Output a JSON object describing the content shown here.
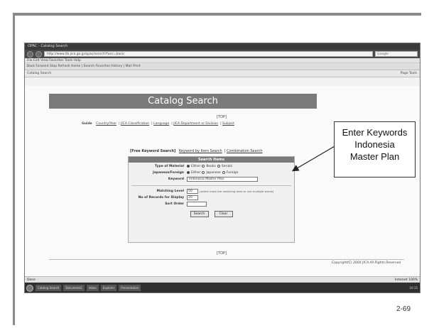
{
  "slide": {
    "page_number": "2-69"
  },
  "browser": {
    "title": "OPAC - Catalog Search",
    "url": "http://www.lib.jica.go.jp/opac/search?func=basic",
    "search_placeholder": "Google",
    "menu": "File  Edit  View  Favorites  Tools  Help",
    "toolbar": "Back  Forward  Stop  Refresh  Home  |  Search  Favorites  History  |  Mail  Print",
    "tab_label": "Catalog Search",
    "tab_tools": "Page  Tools",
    "status_left": "Done",
    "status_right": "Internet  100%",
    "taskbar_items": [
      "Catalog Search",
      "Document1",
      "Inbox",
      "Explorer",
      "Presentation"
    ],
    "tray_time": "10:15"
  },
  "page": {
    "banner": "Catalog Search",
    "top_link": "[TOP]",
    "nav_prefix": "Guide",
    "nav_links": [
      "Country/Year",
      "JICA Classification",
      "Language",
      "JICA Department or Division",
      "Subject"
    ],
    "search_tabs_label": "[Free Keyword Search]",
    "search_tab_links": [
      "Keyword by Item Search",
      "Combination Search"
    ],
    "form_title": "Search Items",
    "type_label": "Type of Material",
    "type_options": [
      "Either",
      "Books",
      "Serials"
    ],
    "lang_label": "Japanese/Foreign",
    "lang_options": [
      "Either",
      "Japanese",
      "Foreign"
    ],
    "keyword_label": "Keyword",
    "keyword_value": "Indonesia Master Plan",
    "match_label": "Matching Level",
    "match_value": "50",
    "match_hint": "(select more the matching level or use multiple words)",
    "records_label": "No of Records for Display",
    "records_value": "20",
    "sort_label": "Sort Order",
    "sort_value": "",
    "search_button": "Search",
    "clear_button": "Clear",
    "bottom_top_link": "[TOP]",
    "copyright": "Copyright(C) 200X JICA All Rights Reserved"
  },
  "callout": {
    "lines": [
      "Enter Keywords",
      "Indonesia",
      "Master Plan"
    ]
  }
}
